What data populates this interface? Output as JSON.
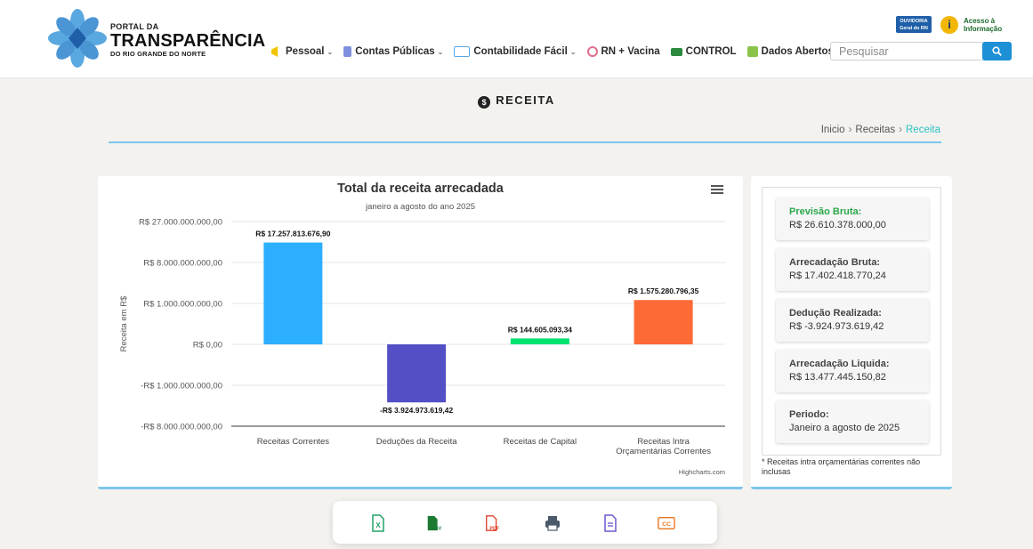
{
  "header": {
    "logo": {
      "line1": "PORTAL DA",
      "line2": "TRANSPARÊNCIA",
      "line3": "DO RIO GRANDE DO NORTE"
    },
    "ouvidoria": {
      "line1": "OUVIDORIA",
      "line2": "Geral do RN"
    },
    "acesso": {
      "line1": "Acesso à",
      "line2": "Informação",
      "icon": "i"
    },
    "nav": [
      {
        "label": "Pessoal",
        "icon": "megaphone-icon",
        "dropdown": true
      },
      {
        "label": "Contas Públicas",
        "icon": "document-icon",
        "dropdown": true
      },
      {
        "label": "Contabilidade Fácil",
        "icon": "chart-icon",
        "dropdown": true
      },
      {
        "label": "RN + Vacina",
        "icon": "vaccine-icon",
        "dropdown": false
      },
      {
        "label": "CONTROL",
        "icon": "control-icon",
        "dropdown": false
      },
      {
        "label": "Dados Abertos",
        "icon": "open-data-icon",
        "dropdown": false
      }
    ],
    "search_placeholder": "Pesquisar"
  },
  "page": {
    "title": "RECEITA",
    "breadcrumb": [
      "Inicio",
      "Receitas",
      "Receita"
    ]
  },
  "chart_data": {
    "type": "bar",
    "title": "Total da receita arrecadada",
    "subtitle": "janeiro a agosto do ano 2025",
    "ylabel": "Receita em R$",
    "yticks": [
      "R$ 27.000.000.000,00",
      "R$ 8.000.000.000,00",
      "R$ 1.000.000.000,00",
      "R$ 0,00",
      "-R$ 1.000.000.000,00",
      "-R$ 8.000.000.000,00"
    ],
    "categories": [
      "Receitas Correntes",
      "Deduções da Receita",
      "Receitas de Capital",
      "Receitas Intra Orçamentárias Correntes"
    ],
    "values": [
      17257813676.9,
      -3924973619.42,
      144605093.34,
      1575280796.35
    ],
    "data_labels": [
      "R$ 17.257.813.676,90",
      "-R$ 3.924.973.619,42",
      "R$ 144.605.093,34",
      "R$ 1.575.280.796,35"
    ],
    "colors": [
      "#2caffe",
      "#544fc5",
      "#00e272",
      "#fe6a35"
    ],
    "credits": "Highcharts.com"
  },
  "summary": {
    "items": [
      {
        "label": "Previsão Bruta:",
        "value": "R$ 26.610.378.000,00",
        "accent": true
      },
      {
        "label": "Arrecadação Bruta:",
        "value": "R$ 17.402.418.770,24",
        "accent": false
      },
      {
        "label": "Dedução Realizada:",
        "value": "R$ -3.924.973.619,42",
        "accent": false
      },
      {
        "label": "Arrecadação Liquida:",
        "value": "R$ 13.477.445.150,82",
        "accent": false
      },
      {
        "label": "Periodo:",
        "value": "Janeiro a agosto de 2025",
        "accent": false
      }
    ],
    "note": "* Receitas intra orçamentárias correntes não inclusas"
  },
  "export": [
    {
      "name": "excel-export-button",
      "icon": "excel-icon",
      "label": "X",
      "color": "#21a366"
    },
    {
      "name": "csv-export-button",
      "icon": "csv-icon",
      "label": "CSV",
      "color": "#1d7a33"
    },
    {
      "name": "pdf-export-button",
      "icon": "pdf-icon",
      "label": "PDF",
      "color": "#e0432f"
    },
    {
      "name": "print-button",
      "icon": "printer-icon",
      "label": "",
      "color": "#4a5a6a"
    },
    {
      "name": "doc-export-button",
      "icon": "document-icon",
      "label": "",
      "color": "#6a5acd"
    },
    {
      "name": "cc-button",
      "icon": "cc-icon",
      "label": "CC",
      "color": "#e8731f"
    }
  ]
}
